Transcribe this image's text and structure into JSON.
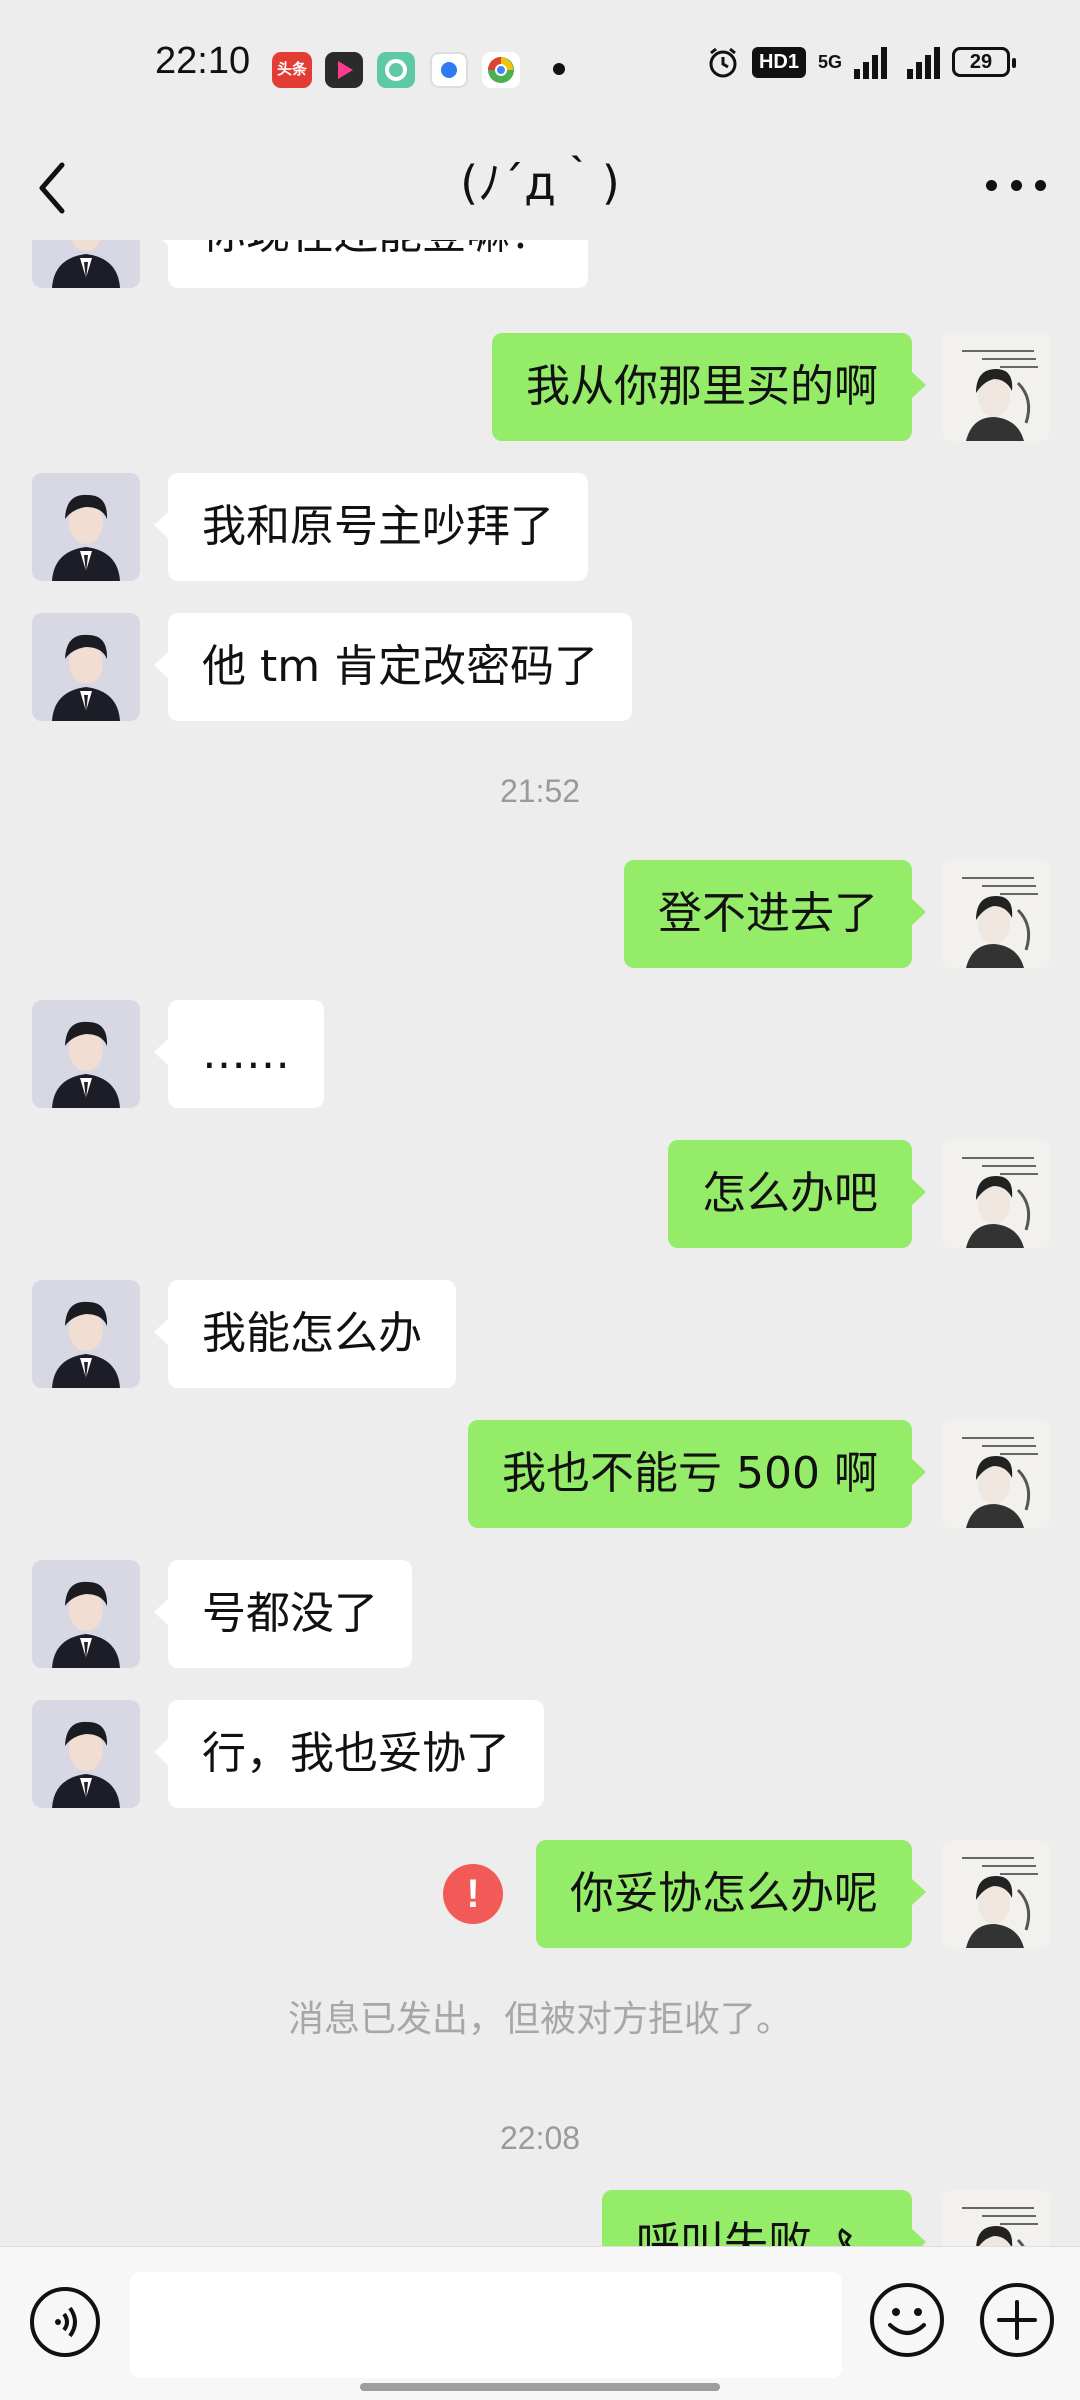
{
  "status_bar": {
    "time": "22:10",
    "badge_toutiao": "头条",
    "net_5g": "5G",
    "hd": "HD1",
    "battery": "29"
  },
  "header": {
    "title": "(ﾉ´д｀)"
  },
  "messages": [
    {
      "side": "left",
      "text": "你现在还能登嘛？"
    },
    {
      "side": "right",
      "text": "我从你那里买的啊"
    },
    {
      "side": "left",
      "text": "我和原号主吵拜了"
    },
    {
      "side": "left",
      "text": "他 tm 肯定改密码了"
    },
    {
      "type": "time",
      "text": "21:52"
    },
    {
      "side": "right",
      "text": "登不进去了"
    },
    {
      "side": "left",
      "text": "……"
    },
    {
      "side": "right",
      "text": "怎么办吧"
    },
    {
      "side": "left",
      "text": "我能怎么办"
    },
    {
      "side": "right",
      "text": "我也不能亏 500 啊"
    },
    {
      "side": "left",
      "text": "号都没了"
    },
    {
      "side": "left",
      "text": "行，我也妥协了"
    },
    {
      "side": "right",
      "text": "你妥协怎么办呢",
      "failed": true
    },
    {
      "type": "system",
      "text": "消息已发出，但被对方拒收了。"
    },
    {
      "type": "time",
      "text": "22:08"
    },
    {
      "side": "right",
      "text": "呼叫失败"
    }
  ],
  "icons": {
    "back": "chevron-left-icon",
    "more": "more-dots-icon",
    "voice": "voice-icon",
    "emoji": "emoji-icon",
    "plus": "plus-icon",
    "error": "error-icon"
  },
  "colors": {
    "bg": "#ededed",
    "own_bubble": "#95ec69",
    "other_bubble": "#ffffff",
    "error": "#f25a57"
  }
}
